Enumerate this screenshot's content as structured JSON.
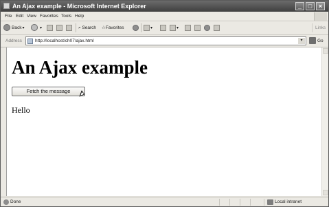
{
  "window": {
    "title": "An Ajax example - Microsoft Internet Explorer"
  },
  "menubar": {
    "items": [
      "File",
      "Edit",
      "View",
      "Favorites",
      "Tools",
      "Help"
    ]
  },
  "toolbar": {
    "back_label": "Back",
    "search_label": "Search",
    "favorites_label": "Favorites",
    "links_label": "Links"
  },
  "addressbar": {
    "label": "Address",
    "url": "http://localhost/ch07/ajax.html",
    "go_label": "Go"
  },
  "page": {
    "heading": "An Ajax example",
    "button_label": "Fetch the message",
    "message": "Hello"
  },
  "statusbar": {
    "status": "Done",
    "zone": "Local intranet"
  }
}
